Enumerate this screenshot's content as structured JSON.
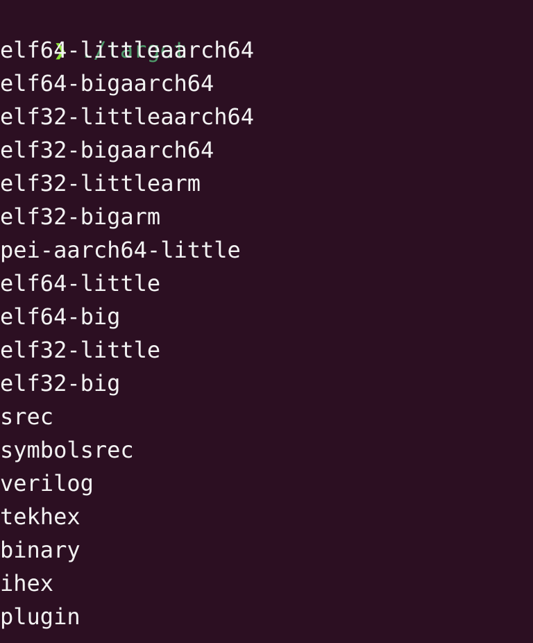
{
  "terminal": {
    "prompt": {
      "symbol": "❯",
      "command": "./target"
    },
    "output": [
      "elf64-littleaarch64",
      "elf64-bigaarch64",
      "elf32-littleaarch64",
      "elf32-bigaarch64",
      "elf32-littlearm",
      "elf32-bigarm",
      "pei-aarch64-little",
      "elf64-little",
      "elf64-big",
      "elf32-little",
      "elf32-big",
      "srec",
      "symbolsrec",
      "verilog",
      "tekhex",
      "binary",
      "ihex",
      "plugin"
    ]
  },
  "colors": {
    "background": "#2c0f22",
    "prompt_symbol": "#8ae234",
    "prompt_command": "#4e9a6a",
    "output_text": "#f2f2f2"
  }
}
